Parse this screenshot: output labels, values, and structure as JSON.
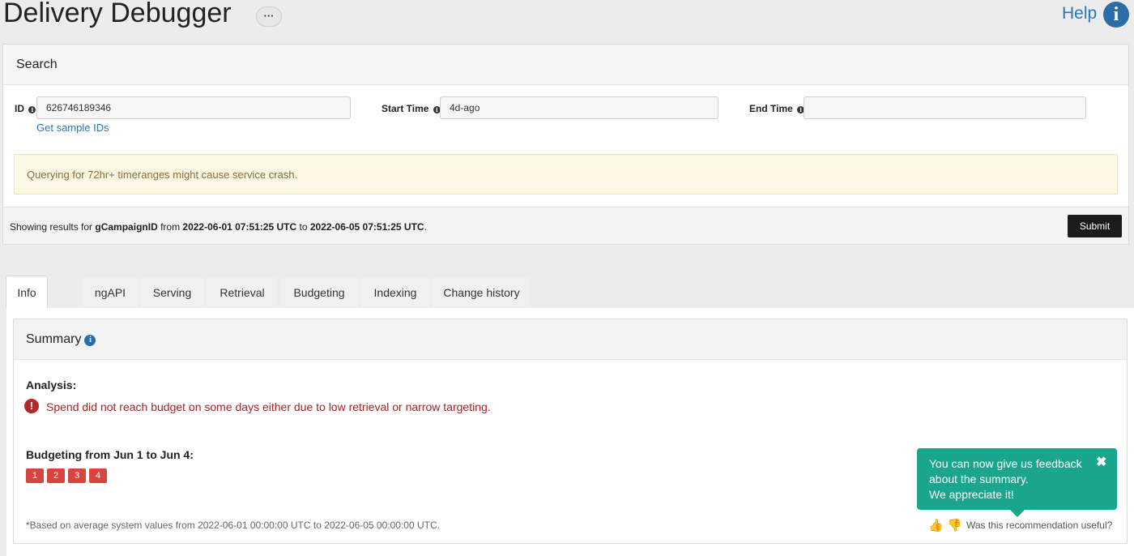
{
  "header": {
    "title": "Delivery Debugger",
    "more_label": "···",
    "help_label": "Help",
    "help_icon": "i"
  },
  "search": {
    "title": "Search",
    "id_label": "ID",
    "id_value": "626746189346",
    "sample_link": "Get sample IDs",
    "start_label": "Start Time",
    "start_value": "4d-ago",
    "end_label": "End Time",
    "end_value": "",
    "info_glyph": "i",
    "warning": "Querying for 72hr+ timeranges might cause service crash.",
    "results_prefix": "Showing results for ",
    "results_entity": "gCampaignID",
    "results_from": " from ",
    "results_start": "2022-06-01 07:51:25 UTC",
    "results_to": " to ",
    "results_end": "2022-06-05 07:51:25 UTC",
    "results_suffix": ".",
    "submit_label": "Submit"
  },
  "tabs": [
    "Info",
    "ngAPI",
    "Serving",
    "Retrieval",
    "Budgeting",
    "Indexing",
    "Change history"
  ],
  "summary": {
    "title": "Summary",
    "info_glyph": "i",
    "analysis_label": "Analysis:",
    "alert_glyph": "!",
    "analysis_text": "Spend did not reach budget on some days either due to low retrieval or narrow targeting.",
    "budget_label": "Budgeting from Jun 1 to Jun 4:",
    "days": [
      "1",
      "2",
      "3",
      "4"
    ],
    "footnote": "*Based on average system values from 2022-06-01 00:00:00 UTC to 2022-06-05 00:00:00 UTC.",
    "feedback_question": "Was this recommendation useful?",
    "thumbs_up_icon": "👍",
    "thumbs_down_icon": "👎"
  },
  "toast": {
    "line1": "You can now give us feedback",
    "line2": "about the summary.",
    "line3": "We appreciate it!",
    "close_icon": "✖"
  },
  "colors": {
    "accent": "#2a75bb",
    "toast": "#1aa68c",
    "alert": "#a42424",
    "badge": "#d9453e",
    "warning_bg": "#fcf7e3"
  }
}
